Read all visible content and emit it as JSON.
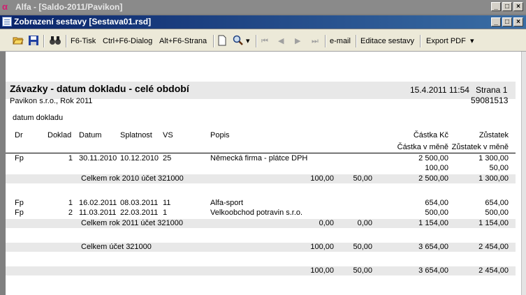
{
  "app": {
    "logo": "α",
    "title": "Alfa - [Saldo-2011/Pavikon]"
  },
  "window": {
    "title": "Zobrazení sestavy [Sestava01.rsd]"
  },
  "toolbar": {
    "open_icon": "folder-open-icon",
    "save_icon": "floppy-icon",
    "find_icon": "binoculars-icon",
    "f6_print": "F6-Tisk",
    "ctrl_f6_dialog": "Ctrl+F6-Dialog",
    "alt_f6_page": "Alt+F6-Strana",
    "page_icon": "page-icon",
    "zoom_icon": "magnifier-icon",
    "email": "e-mail",
    "edit_report": "Editace sestavy",
    "export_pdf": "Export PDF"
  },
  "report": {
    "title": "Závazky - datum dokladu - celé období",
    "datetime": "15.4.2011 11:54",
    "page": "Strana 1",
    "company": "Pavikon s.r.o., Rok 2011",
    "code": "59081513",
    "filter": "datum dokladu",
    "headers": {
      "dr": "Dr",
      "doklad": "Doklad",
      "datum": "Datum",
      "splatnost": "Splatnost",
      "vs": "VS",
      "popis": "Popis",
      "castka_kc": "Částka Kč",
      "zustatek": "Zůstatek",
      "castka_mena": "Částka v měně",
      "zustatek_mena": "Zůstatek v měně"
    },
    "rows": [
      {
        "dr": "Fp",
        "doklad": "1",
        "datum": "30.11.2010",
        "splatnost": "10.12.2010",
        "vs": "25",
        "popis": "Německá firma - plátce DPH",
        "castka": "2 500,00",
        "zustatek": "1 300,00",
        "castka_mena": "100,00",
        "zustatek_mena": "50,00"
      },
      {
        "dr": "Fp",
        "doklad": "1",
        "datum": "16.02.2011",
        "splatnost": "08.03.2011",
        "vs": "11",
        "popis": "Alfa-sport",
        "castka": "654,00",
        "zustatek": "654,00"
      },
      {
        "dr": "Fp",
        "doklad": "2",
        "datum": "11.03.2011",
        "splatnost": "22.03.2011",
        "vs": "1",
        "popis": "Velkoobchod potravin s.r.o.",
        "castka": "500,00",
        "zustatek": "500,00"
      }
    ],
    "totals": [
      {
        "label": "Celkem rok 2010 účet 321000",
        "a": "100,00",
        "b": "50,00",
        "castka": "2 500,00",
        "zustatek": "1 300,00"
      },
      {
        "label": "Celkem rok 2011 účet 321000",
        "a": "0,00",
        "b": "0,00",
        "castka": "1 154,00",
        "zustatek": "1 154,00"
      },
      {
        "label": "Celkem účet 321000",
        "a": "100,00",
        "b": "50,00",
        "castka": "3 654,00",
        "zustatek": "2 454,00"
      },
      {
        "label": "",
        "a": "100,00",
        "b": "50,00",
        "castka": "3 654,00",
        "zustatek": "2 454,00"
      }
    ]
  }
}
